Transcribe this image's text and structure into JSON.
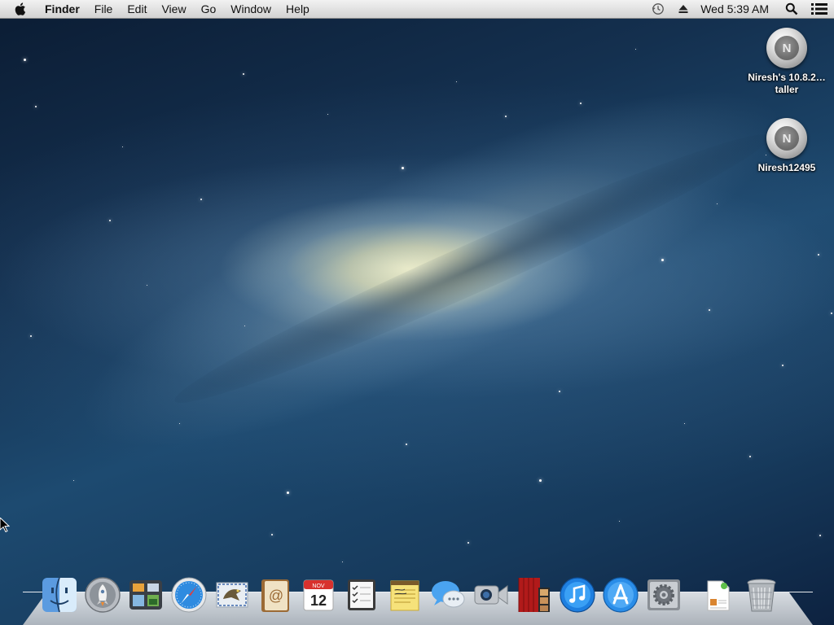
{
  "menubar": {
    "apple_icon": "apple-icon",
    "app_name": "Finder",
    "menus": [
      "File",
      "Edit",
      "View",
      "Go",
      "Window",
      "Help"
    ],
    "clock": "Wed 5:39 AM",
    "status_icons": [
      "time-machine-icon",
      "eject-icon",
      "spotlight-search-icon",
      "notification-center-icon"
    ]
  },
  "desktop": {
    "icons": [
      {
        "label": "Niresh's 10.8.2…taller",
        "icon": "disk-image-icon"
      },
      {
        "label": "Niresh12495",
        "icon": "disk-image-icon"
      }
    ]
  },
  "dock": {
    "apps": [
      "finder-icon",
      "launchpad-icon",
      "mission-control-icon",
      "safari-icon",
      "mail-icon",
      "contacts-icon",
      "calendar-icon",
      "reminders-icon",
      "notes-icon",
      "messages-icon",
      "facetime-icon",
      "photo-booth-icon",
      "itunes-icon",
      "app-store-icon",
      "system-preferences-icon"
    ],
    "calendar": {
      "month": "NOV",
      "day": "12"
    },
    "stacks": [
      "document-stack-icon",
      "trash-icon"
    ]
  },
  "colors": {
    "menubar_top": "#f2f2f2",
    "menubar_bottom": "#d2d2d2",
    "wallpaper_deep": "#0b1c33",
    "wallpaper_mid": "#1d4a70",
    "galaxy_core": "#fff8c8"
  }
}
